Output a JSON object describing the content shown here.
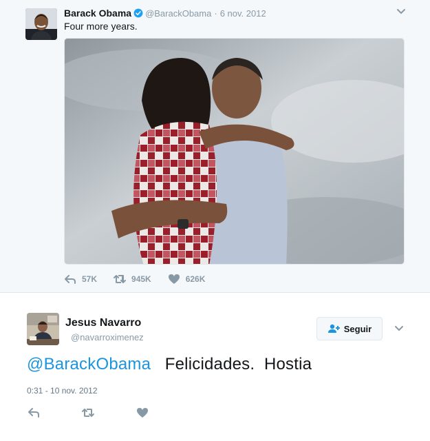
{
  "quoted_tweet": {
    "author_name": "Barack Obama",
    "verified_icon": "verified-badge-icon",
    "handle": "@BarackObama",
    "separator": "·",
    "date": "6 nov. 2012",
    "text": "Four more years.",
    "photo_icon": "photo-couple-embrace",
    "actions": {
      "reply_count": "57K",
      "retweet_count": "945K",
      "like_count": "626K"
    }
  },
  "main_tweet": {
    "author_name": "Jesus Navarro",
    "handle": "@navarroximenez",
    "follow_label": "Seguir",
    "mention": "@BarackObama",
    "text_rest": "   Felicidades.  Hostia",
    "timestamp": "0:31 - 10 nov. 2012"
  },
  "colors": {
    "accent": "#1b95e0",
    "muted": "#8899a6",
    "verified": "#1da1f2",
    "quoted_background": "#f5f8fa"
  }
}
